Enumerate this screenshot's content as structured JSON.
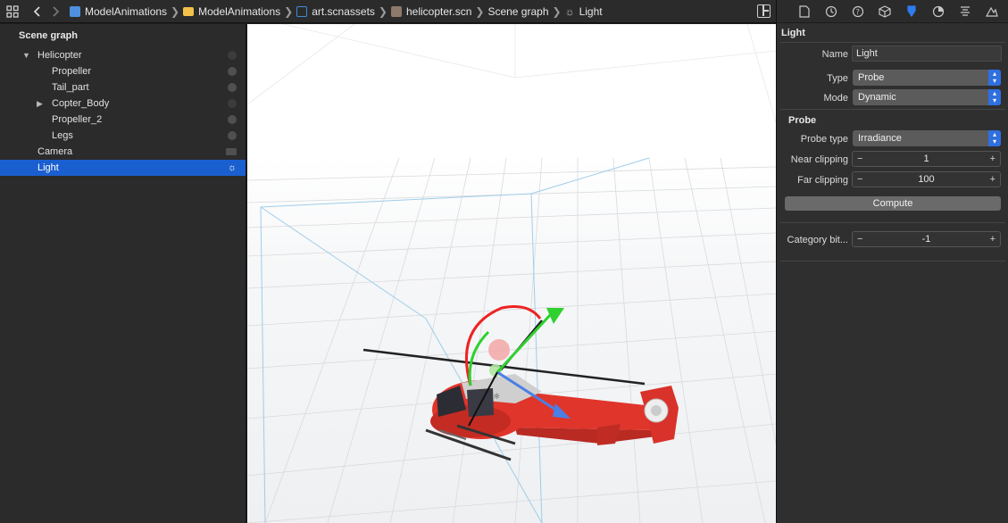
{
  "breadcrumbs": [
    {
      "label": "ModelAnimations",
      "icon": "project-doc-icon"
    },
    {
      "label": "ModelAnimations",
      "icon": "folder-icon"
    },
    {
      "label": "art.scnassets",
      "icon": "assets-folder-icon"
    },
    {
      "label": "helicopter.scn",
      "icon": "scene-file-icon"
    },
    {
      "label": "Scene graph",
      "icon": ""
    },
    {
      "label": "Light",
      "icon": "light-icon"
    }
  ],
  "outline": {
    "title": "Scene graph",
    "items": [
      {
        "label": "Helicopter"
      },
      {
        "label": "Propeller"
      },
      {
        "label": "Tail_part"
      },
      {
        "label": "Copter_Body"
      },
      {
        "label": "Propeller_2"
      },
      {
        "label": "Legs"
      },
      {
        "label": "Camera"
      },
      {
        "label": "Light"
      }
    ]
  },
  "inspector": {
    "tabs": [
      "file-inspector",
      "history-inspector",
      "help-inspector",
      "node-inspector",
      "attributes-inspector",
      "material-inspector",
      "physics-inspector",
      "scene-inspector"
    ],
    "light_section": {
      "title": "Light",
      "name_label": "Name",
      "name_value": "Light",
      "type_label": "Type",
      "type_value": "Probe",
      "mode_label": "Mode",
      "mode_value": "Dynamic"
    },
    "probe_section": {
      "title": "Probe",
      "probe_type_label": "Probe type",
      "probe_type_value": "Irradiance",
      "near_label": "Near clipping",
      "near_value": "1",
      "far_label": "Far clipping",
      "far_value": "100",
      "compute_label": "Compute"
    },
    "category_label": "Category bit...",
    "category_value": "-1"
  },
  "colors": {
    "selection": "#1a5fd0",
    "accent": "#2f7bf0",
    "helicopter_body": "#e0352b"
  }
}
